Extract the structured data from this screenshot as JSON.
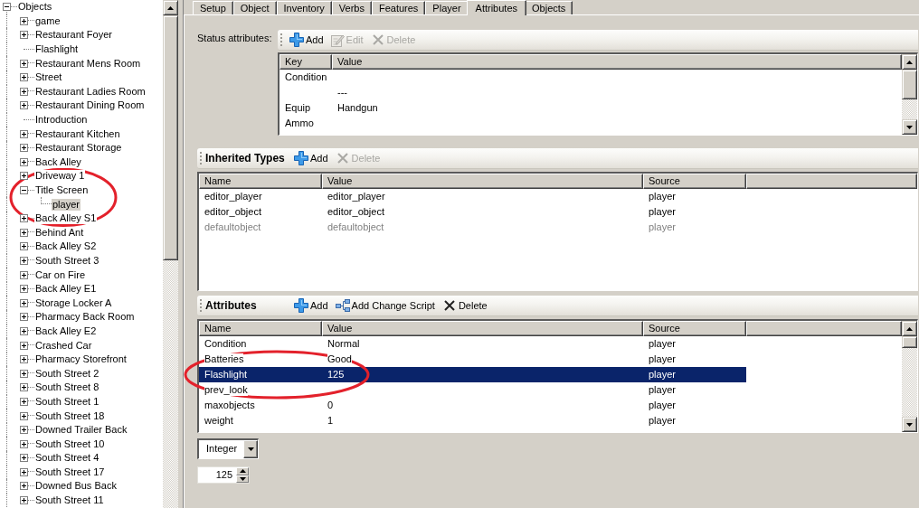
{
  "tree": {
    "items": [
      {
        "label": "Objects",
        "expanded": true,
        "selected": false,
        "children": [
          {
            "label": "game",
            "expanded": false,
            "selected": false
          },
          {
            "label": "Restaurant Foyer",
            "expanded": false,
            "selected": false
          },
          {
            "label": "Flashlight",
            "selected": false
          },
          {
            "label": "Restaurant Mens Room",
            "expanded": false,
            "selected": false
          },
          {
            "label": "Street",
            "expanded": false,
            "selected": false
          },
          {
            "label": "Restaurant Ladies Room",
            "expanded": false,
            "selected": false
          },
          {
            "label": "Restaurant Dining Room",
            "expanded": false,
            "selected": false
          },
          {
            "label": "Introduction",
            "selected": false
          },
          {
            "label": "Restaurant Kitchen",
            "expanded": false,
            "selected": false
          },
          {
            "label": "Restaurant Storage",
            "expanded": false,
            "selected": false
          },
          {
            "label": "Back Alley",
            "expanded": false,
            "selected": false
          },
          {
            "label": "Driveway 1",
            "expanded": false,
            "selected": false
          },
          {
            "label": "Title Screen",
            "expanded": true,
            "selected": false,
            "children": [
              {
                "label": "player",
                "selected": true
              }
            ]
          },
          {
            "label": "Back Alley S1",
            "expanded": false,
            "selected": false
          },
          {
            "label": "Behind Ant",
            "expanded": false,
            "selected": false
          },
          {
            "label": "Back Alley S2",
            "expanded": false,
            "selected": false
          },
          {
            "label": "South Street 3",
            "expanded": false,
            "selected": false
          },
          {
            "label": "Car on Fire",
            "expanded": false,
            "selected": false
          },
          {
            "label": "Back Alley E1",
            "expanded": false,
            "selected": false
          },
          {
            "label": "Storage Locker A",
            "expanded": false,
            "selected": false
          },
          {
            "label": "Pharmacy Back Room",
            "expanded": false,
            "selected": false
          },
          {
            "label": "Back Alley E2",
            "expanded": false,
            "selected": false
          },
          {
            "label": "Crashed Car",
            "expanded": false,
            "selected": false
          },
          {
            "label": "Pharmacy Storefront",
            "expanded": false,
            "selected": false
          },
          {
            "label": "South Street 2",
            "expanded": false,
            "selected": false
          },
          {
            "label": "South Street 8",
            "expanded": false,
            "selected": false
          },
          {
            "label": "South Street 1",
            "expanded": false,
            "selected": false
          },
          {
            "label": "South Street 18",
            "expanded": false,
            "selected": false
          },
          {
            "label": "Downed Trailer Back",
            "expanded": false,
            "selected": false
          },
          {
            "label": "South Street 10",
            "expanded": false,
            "selected": false
          },
          {
            "label": "South Street 4",
            "expanded": false,
            "selected": false
          },
          {
            "label": "South Street 17",
            "expanded": false,
            "selected": false
          },
          {
            "label": "Downed Bus Back",
            "expanded": false,
            "selected": false
          },
          {
            "label": "South Street 11",
            "expanded": false,
            "selected": false
          }
        ]
      }
    ]
  },
  "tabs": [
    {
      "label": "Setup",
      "selected": false
    },
    {
      "label": "Object",
      "selected": false
    },
    {
      "label": "Inventory",
      "selected": false
    },
    {
      "label": "Verbs",
      "selected": false
    },
    {
      "label": "Features",
      "selected": false
    },
    {
      "label": "Player",
      "selected": false
    },
    {
      "label": "Attributes",
      "selected": true
    },
    {
      "label": "Objects",
      "selected": false
    }
  ],
  "status_attributes": {
    "label": "Status attributes:",
    "toolbar": [
      {
        "label": "Add",
        "kind": "add",
        "disabled": false
      },
      {
        "label": "Edit",
        "kind": "edit",
        "disabled": true
      },
      {
        "label": "Delete",
        "kind": "delete",
        "disabled": true
      }
    ],
    "columns": [
      "Key",
      "Value"
    ],
    "rows": [
      {
        "key": "Condition",
        "selected": false
      },
      {
        "value": "---",
        "selected": false
      },
      {
        "key": "Equip",
        "value": "Handgun",
        "selected": false
      },
      {
        "key": "Ammo",
        "selected": false
      }
    ]
  },
  "inherited_types": {
    "title": "Inherited Types",
    "toolbar": [
      {
        "label": "Add",
        "kind": "add",
        "disabled": false
      },
      {
        "label": "Delete",
        "kind": "delete",
        "disabled": true
      }
    ],
    "columns": [
      "Name",
      "Value",
      "Source"
    ],
    "rows": [
      {
        "name": "editor_player",
        "value": "editor_player",
        "source": "player",
        "disabled": false,
        "selected": false
      },
      {
        "name": "editor_object",
        "value": "editor_object",
        "source": "player",
        "disabled": false,
        "selected": false
      },
      {
        "name": "defaultobject",
        "value": "defaultobject",
        "source": "player",
        "disabled": true,
        "selected": false
      }
    ]
  },
  "attributes": {
    "title": "Attributes",
    "toolbar": [
      {
        "label": "Add",
        "kind": "add",
        "disabled": false
      },
      {
        "label": "Add Change Script",
        "kind": "script",
        "disabled": false
      },
      {
        "label": "Delete",
        "kind": "delete",
        "disabled": false
      }
    ],
    "columns": [
      "Name",
      "Value",
      "Source"
    ],
    "rows": [
      {
        "name": "Condition",
        "value": "Normal",
        "source": "player",
        "selected": false
      },
      {
        "name": "Batteries",
        "value": "Good",
        "source": "player",
        "selected": false
      },
      {
        "name": "Flashlight",
        "value": "125",
        "source": "player",
        "selected": true
      },
      {
        "name": "prev_look",
        "source": "player",
        "selected": false
      },
      {
        "name": "maxobjects",
        "value": "0",
        "source": "player",
        "selected": false
      },
      {
        "name": "weight",
        "value": "1",
        "source": "player",
        "selected": false
      }
    ]
  },
  "value_type": {
    "value": "Integer"
  },
  "value_input": {
    "value": "125"
  }
}
